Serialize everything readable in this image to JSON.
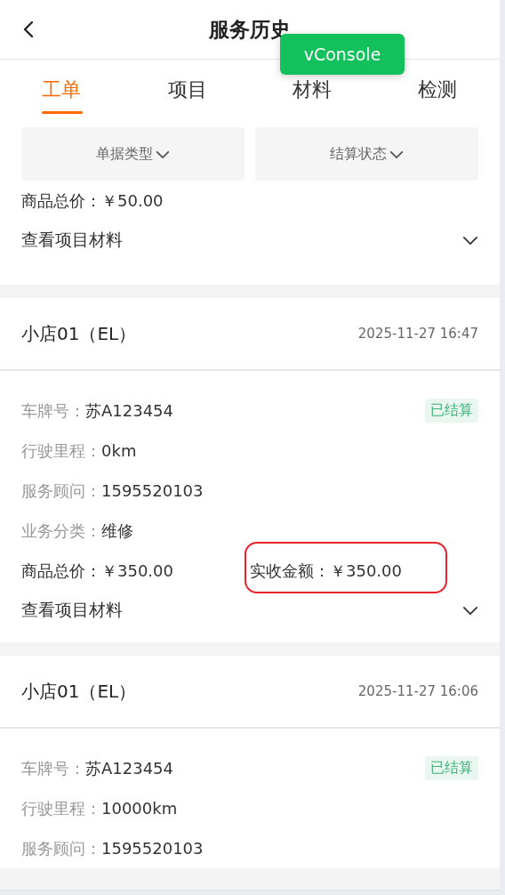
{
  "header": {
    "title": "服务历史"
  },
  "debug_button": {
    "label": "vConsole"
  },
  "tabs": [
    {
      "label": "工单",
      "selected": true
    },
    {
      "label": "项目",
      "selected": false
    },
    {
      "label": "材料",
      "selected": false
    },
    {
      "label": "检测",
      "selected": false
    }
  ],
  "filters": [
    {
      "label": "单据类型"
    },
    {
      "label": "结算状态"
    }
  ],
  "cards": [
    {
      "amounts": [
        {
          "label": "商品总价：",
          "value": "￥50.00",
          "highlighted": false
        }
      ],
      "expand_label": "查看项目材料",
      "expanded": false
    },
    {
      "title": "小店01（EL）",
      "time": "2025-11-27 16:47",
      "status": "已结算",
      "fields": [
        {
          "label": "车牌号：",
          "value": "苏A123454"
        },
        {
          "label": "行驶里程：",
          "value": "0km"
        },
        {
          "label": "服务顾问：",
          "value": "1595520103"
        },
        {
          "label": "业务分类：",
          "value": "维修"
        }
      ],
      "amounts": [
        {
          "label": "商品总价：",
          "value": "￥350.00",
          "highlighted": false
        },
        {
          "label": "实收金额：",
          "value": "￥350.00",
          "highlighted": true
        }
      ],
      "expand_label": "查看项目材料",
      "expanded": false
    },
    {
      "title": "小店01（EL）",
      "time": "2025-11-27 16:06",
      "status": "已结算",
      "fields": [
        {
          "label": "车牌号：",
          "value": "苏A123454"
        },
        {
          "label": "行驶里程：",
          "value": "10000km"
        },
        {
          "label": "服务顾问：",
          "value": "1595520103"
        }
      ]
    }
  ]
}
